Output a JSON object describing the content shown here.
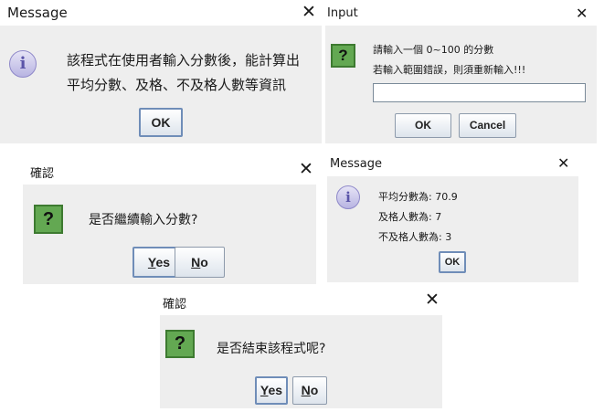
{
  "dialog1": {
    "title": "Message",
    "close": "✕",
    "line1": "該程式在使用者輸入分數後，能計算出",
    "line2": "平均分數、及格、不及格人數等資訊",
    "ok": "OK"
  },
  "dialog2": {
    "title": "Input",
    "close": "✕",
    "line1": "請輸入一個 0~100 的分數",
    "line2": "若輸入範圍錯誤，則須重新輸入!!!",
    "input_value": "",
    "ok": "OK",
    "cancel": "Cancel"
  },
  "dialog3": {
    "title": "確認",
    "close": "✕",
    "question": "是否繼續輸入分數?",
    "yes_first": "Y",
    "yes_rest": "es",
    "no_first": "N",
    "no_rest": "o"
  },
  "dialog4": {
    "title": "Message",
    "close": "✕",
    "line1": "平均分數為: 70.9",
    "line2": "及格人數為: 7",
    "line3": "不及格人數為: 3",
    "ok": "OK"
  },
  "dialog5": {
    "title": "確認",
    "close": "✕",
    "question": "是否結束該程式呢?",
    "yes_first": "Y",
    "yes_rest": "es",
    "no_first": "N",
    "no_rest": "o"
  },
  "icons": {
    "info": "i",
    "question": "?"
  },
  "colors": {
    "dialog_bg": "#eeeeee",
    "question_icon": "#63a852",
    "info_icon": "#b8b4e2"
  }
}
